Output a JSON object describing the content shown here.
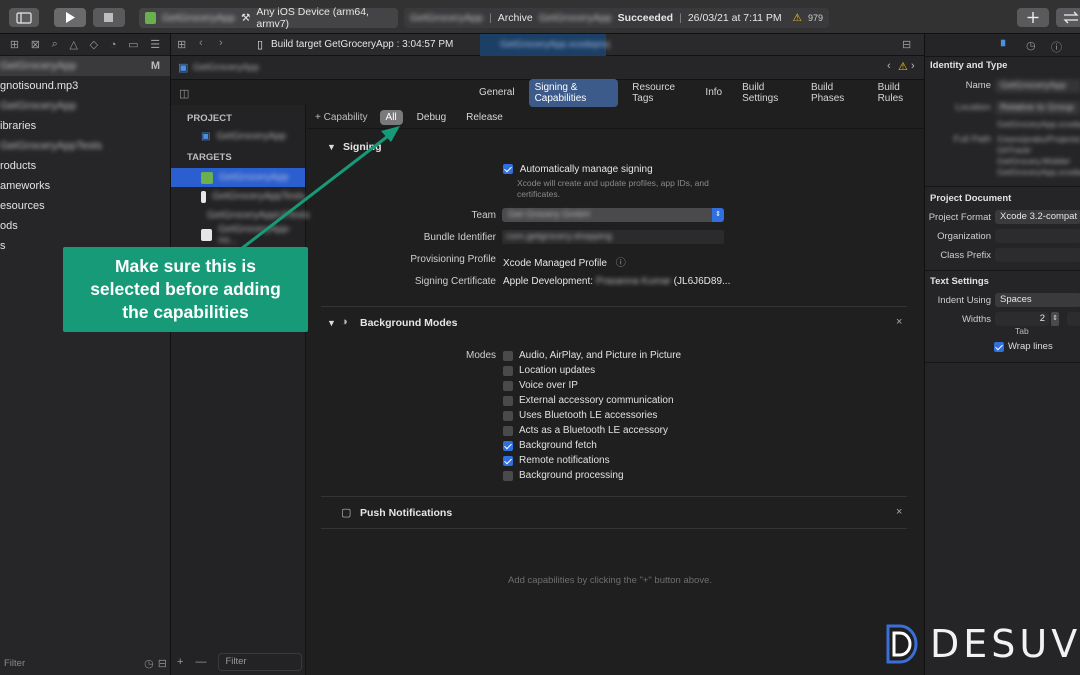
{
  "toolbar": {
    "scheme_blurred": "GetGroceryApp",
    "device": "Any iOS Device (arm64, armv7)",
    "activity_project_blurred": "GetGroceryApp",
    "activity_action": "Archive",
    "activity_target_blurred": "GetGroceryApp",
    "activity_status": "Succeeded",
    "activity_time": "26/03/21 at 7:11 PM",
    "warning_count": "979"
  },
  "navigator": {
    "items": [
      {
        "label": "GetGroceryApp",
        "badge": "M",
        "blurred": true
      },
      {
        "label": "gnotisound.mp3",
        "blurred": false
      },
      {
        "label": "GetGroceryApp",
        "blurred": true
      },
      {
        "label": "ibraries",
        "blurred": false
      },
      {
        "label": "GetGroceryAppTests",
        "blurred": true
      },
      {
        "label": "roducts",
        "blurred": false
      },
      {
        "label": "ameworks",
        "blurred": false
      },
      {
        "label": "esources",
        "blurred": false
      },
      {
        "label": "ods",
        "blurred": false
      },
      {
        "label": "s",
        "blurred": false
      }
    ],
    "filter_placeholder": "Filter"
  },
  "editor": {
    "tab_title": "Build target GetGroceryApp : 3:04:57 PM",
    "file_tab_blurred": "GetGroceryApp.xcodeproj",
    "jump_blurred": "GetGroceryApp",
    "project_header": "PROJECT",
    "project_item_blurred": "GetGroceryApp",
    "targets_header": "TARGETS",
    "targets_blurred": [
      "GetGroceryApp",
      "GetGroceryAppTests",
      "GetGroceryAppUITests",
      "GetGroceryApp-no..."
    ],
    "tabs": [
      "General",
      "Signing & Capabilities",
      "Resource Tags",
      "Info",
      "Build Settings",
      "Build Phases",
      "Build Rules"
    ],
    "active_tab_index": 1,
    "capability_label": "Capability",
    "config_tabs": [
      "All",
      "Debug",
      "Release"
    ],
    "targets_filter_placeholder": "Filter"
  },
  "signing": {
    "title": "Signing",
    "auto_manage": "Automatically manage signing",
    "auto_manage_checked": true,
    "auto_manage_desc": "Xcode will create and update profiles, app IDs, and certificates.",
    "team_label": "Team",
    "team_value_blurred": "Get Grocery GmbH",
    "bundle_label": "Bundle Identifier",
    "bundle_value_blurred": "com.getgrocery.shopping",
    "profile_label": "Provisioning Profile",
    "profile_value": "Xcode Managed Profile",
    "cert_label": "Signing Certificate",
    "cert_value_prefix": "Apple Development:",
    "cert_value_blurred": "Prasanna Kumar",
    "cert_value_suffix": "(JL6J6D89..."
  },
  "background_modes": {
    "title": "Background Modes",
    "modes_label": "Modes",
    "options": [
      {
        "label": "Audio, AirPlay, and Picture in Picture",
        "checked": false
      },
      {
        "label": "Location updates",
        "checked": false
      },
      {
        "label": "Voice over IP",
        "checked": false
      },
      {
        "label": "External accessory communication",
        "checked": false
      },
      {
        "label": "Uses Bluetooth LE accessories",
        "checked": false
      },
      {
        "label": "Acts as a Bluetooth LE accessory",
        "checked": false
      },
      {
        "label": "Background fetch",
        "checked": true
      },
      {
        "label": "Remote notifications",
        "checked": true
      },
      {
        "label": "Background processing",
        "checked": false
      }
    ]
  },
  "push": {
    "title": "Push Notifications"
  },
  "hint": "Add capabilities by clicking the \"+\" button above.",
  "inspector": {
    "identity_header": "Identity and Type",
    "name_label": "Name",
    "name_blurred": "GetGroceryApp",
    "location_label": "Location",
    "location_blurred": "Relative to Group",
    "location_path_blurred": "GetGroceryApp.xcodeproj",
    "fullpath_label": "Full Path",
    "fullpath_blurred": [
      "/Users/prabu/Projects/",
      "GitTrack/",
      "GetGrocery.Mobile/",
      "GetGroceryApp.xcodeproj"
    ],
    "doc_header": "Project Document",
    "format_label": "Project Format",
    "format_value": "Xcode 3.2-compat",
    "org_label": "Organization",
    "prefix_label": "Class Prefix",
    "text_header": "Text Settings",
    "indent_label": "Indent Using",
    "indent_value": "Spaces",
    "widths_label": "Widths",
    "widths_value": "2",
    "tab_label": "Tab",
    "wrap_label": "Wrap lines",
    "wrap_checked": true
  },
  "callout": {
    "line1": "Make sure this is",
    "line2": "selected before adding",
    "line3": "the capabilities"
  },
  "watermark": "DESUV",
  "colors": {
    "accent": "#2f6fe0",
    "callout": "#169a77",
    "warning": "#f5c518"
  }
}
